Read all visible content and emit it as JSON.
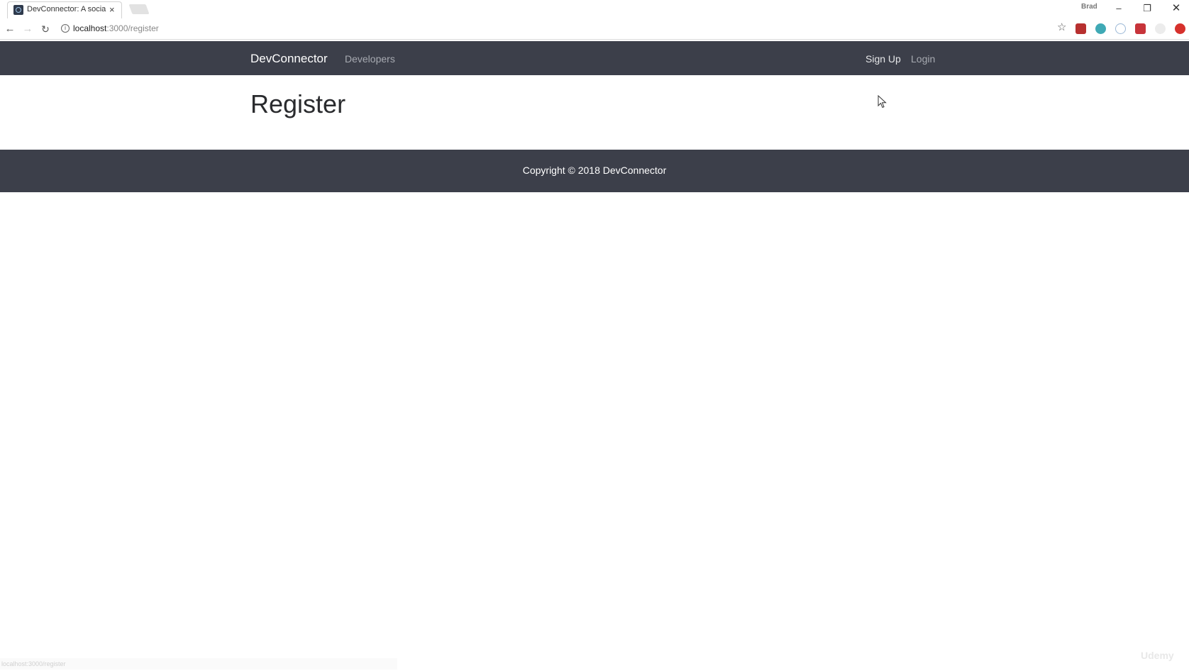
{
  "browser": {
    "tab": {
      "title": "DevConnector: A social n",
      "close_glyph": "×"
    },
    "profile_badge": "Brad",
    "window_controls": {
      "minimize": "–",
      "maximize": "❐",
      "close": "✕"
    },
    "toolbar": {
      "back_glyph": "←",
      "forward_glyph": "→",
      "reload_glyph": "↻",
      "url_host": "localhost",
      "url_path": ":3000/register",
      "info_glyph": "i",
      "star_glyph": "☆"
    },
    "extension_icons": [
      "chart-extension-icon",
      "teal-extension-icon",
      "circle-extension-icon",
      "red-extension-icon",
      "grey-extension-icon",
      "opera-extension-icon"
    ],
    "status_bar_text": "localhost:3000/register"
  },
  "site": {
    "navbar": {
      "brand": "DevConnector",
      "links": {
        "developers": "Developers",
        "sign_up": "Sign Up",
        "login": "Login"
      },
      "background": "#3c3f4a"
    },
    "main": {
      "title": "Register"
    },
    "footer": {
      "text": "Copyright © 2018 DevConnector"
    }
  },
  "watermark": "Udemy"
}
